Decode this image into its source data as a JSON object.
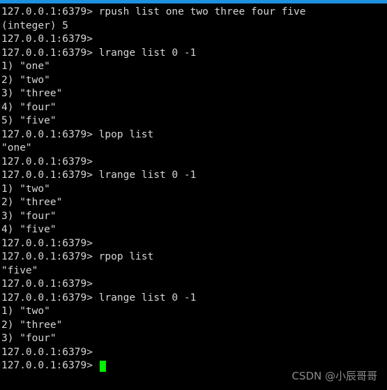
{
  "window": {
    "title_bar_color": "#1e90e0",
    "background_color": "#000000",
    "text_color": "#d6d6d6",
    "cursor_color": "#00f000"
  },
  "terminal": {
    "prompt": "127.0.0.1:6379>",
    "lines": [
      "127.0.0.1:6379> rpush list one two three four five",
      "(integer) 5",
      "127.0.0.1:6379>",
      "127.0.0.1:6379> lrange list 0 -1",
      "1) \"one\"",
      "2) \"two\"",
      "3) \"three\"",
      "4) \"four\"",
      "5) \"five\"",
      "127.0.0.1:6379> lpop list",
      "\"one\"",
      "127.0.0.1:6379>",
      "127.0.0.1:6379> lrange list 0 -1",
      "1) \"two\"",
      "2) \"three\"",
      "3) \"four\"",
      "4) \"five\"",
      "127.0.0.1:6379>",
      "127.0.0.1:6379> rpop list",
      "\"five\"",
      "127.0.0.1:6379>",
      "127.0.0.1:6379> lrange list 0 -1",
      "1) \"two\"",
      "2) \"three\"",
      "3) \"four\"",
      "127.0.0.1:6379>"
    ],
    "current_prompt": "127.0.0.1:6379> ",
    "current_input": ""
  },
  "watermark": {
    "text": "CSDN @小辰哥哥"
  }
}
